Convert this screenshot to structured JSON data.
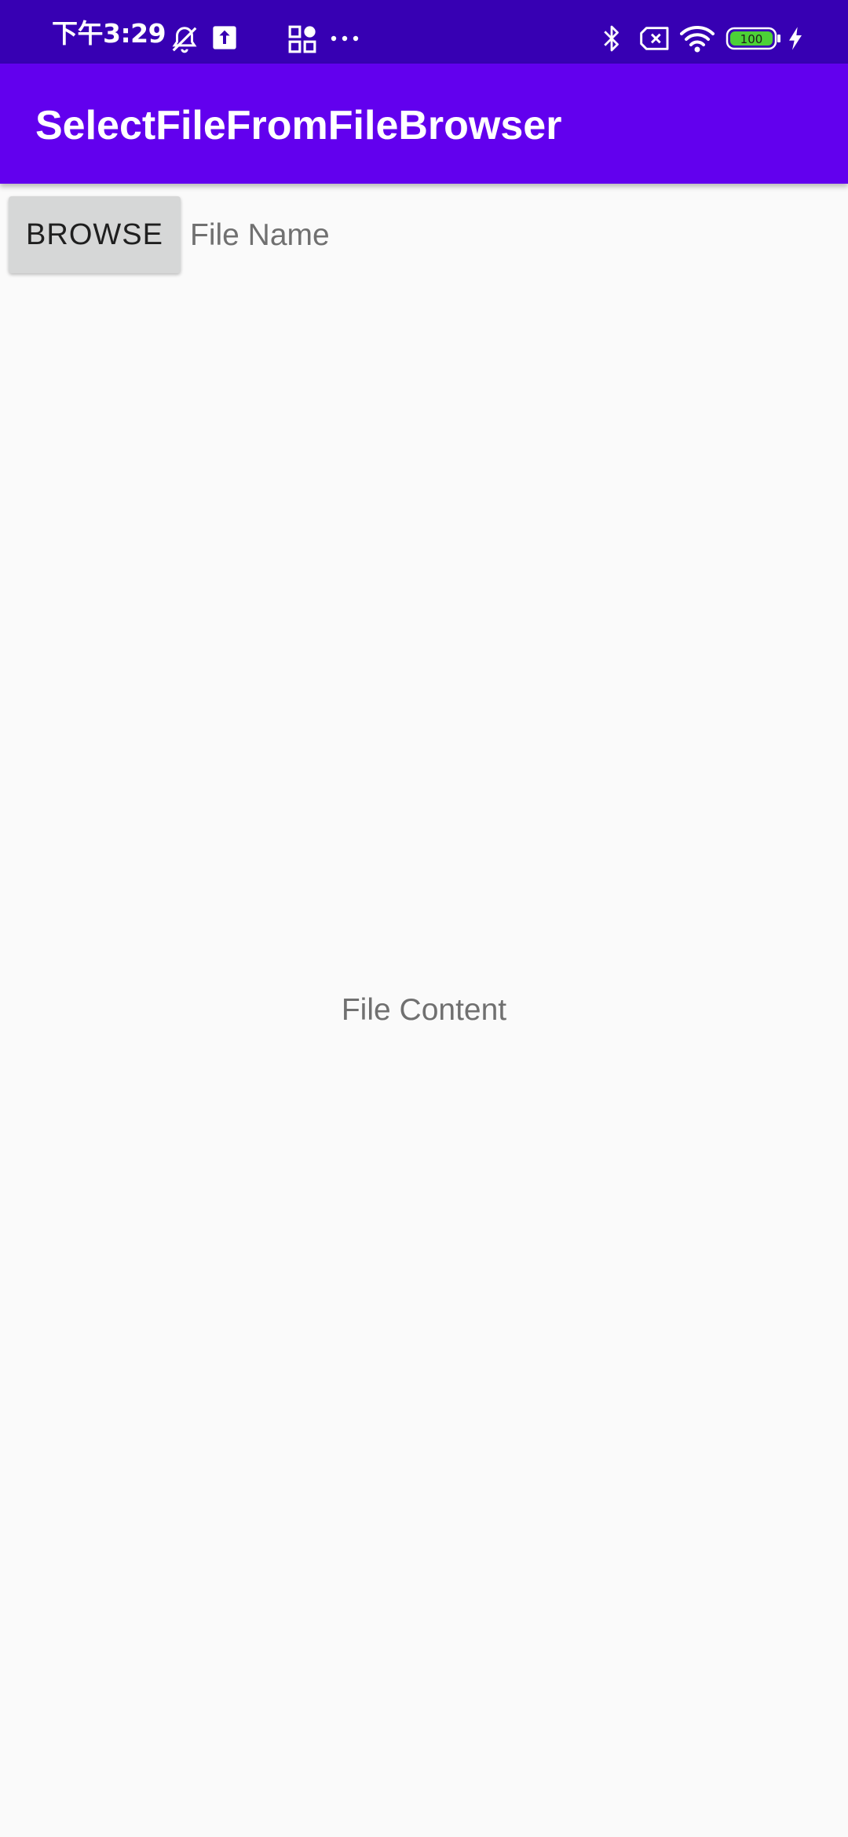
{
  "status_bar": {
    "time": "下午3:29",
    "icons": [
      "alarm-off-icon",
      "upload-icon",
      "apps-icon",
      "more-icon",
      "bluetooth-icon",
      "no-sim-icon",
      "wifi-icon",
      "battery-icon",
      "charging-icon"
    ],
    "battery_level": "100",
    "colors": {
      "background": "#3700b3",
      "battery_fill": "#4cd137"
    }
  },
  "app_bar": {
    "title": "SelectFileFromFileBrowser",
    "color": "#6200ee"
  },
  "main": {
    "browse_label": "BROWSE",
    "file_name": "File Name",
    "file_content": "File Content"
  }
}
